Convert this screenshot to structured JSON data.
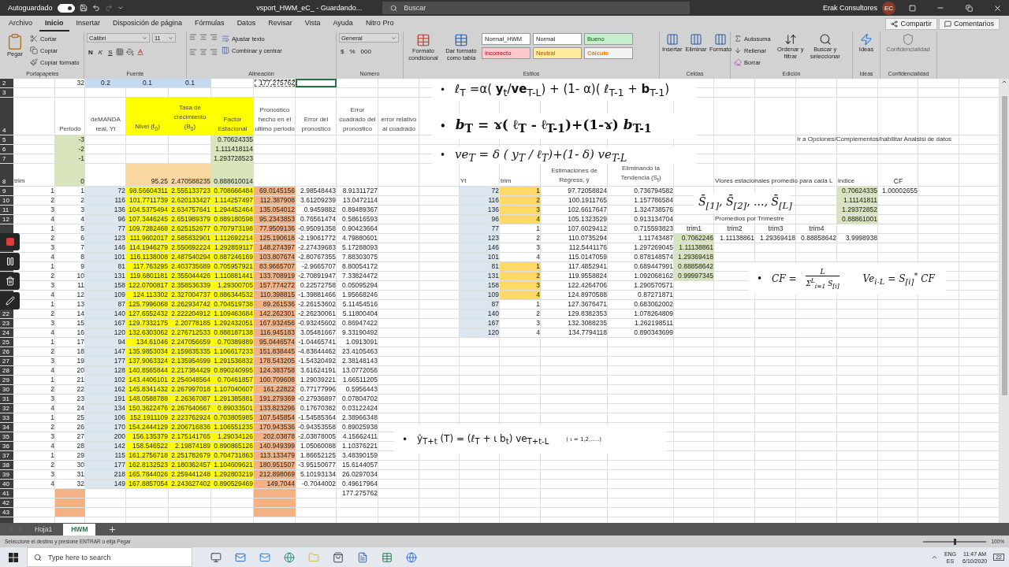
{
  "title_bar": {
    "autosave_label": "Autoguardado",
    "autosave_on": true,
    "document_title": "vsport_HWM_eC_  -  Guardando...",
    "search_placeholder": "Buscar",
    "user_name": "Erak Consultores",
    "user_initials": "EC"
  },
  "menu_tabs": [
    {
      "label": "Archivo",
      "selected": false
    },
    {
      "label": "Inicio",
      "selected": true
    },
    {
      "label": "Insertar",
      "selected": false
    },
    {
      "label": "Disposición de página",
      "selected": false
    },
    {
      "label": "Fórmulas",
      "selected": false
    },
    {
      "label": "Datos",
      "selected": false
    },
    {
      "label": "Revisar",
      "selected": false
    },
    {
      "label": "Vista",
      "selected": false
    },
    {
      "label": "Ayuda",
      "selected": false
    },
    {
      "label": "Nitro Pro",
      "selected": false
    }
  ],
  "share_button": "Compartir",
  "comments_button": "Comentarios",
  "ribbon": [
    {
      "kind": "clipboard",
      "label": "Portapapeles",
      "main": "Pegar",
      "items": [
        "Cortar",
        "Copiar",
        "Copiar formato"
      ]
    },
    {
      "kind": "font",
      "label": "Fuente",
      "font_name": "Calibri",
      "font_size": "11",
      "styles": [
        "N",
        "K",
        "S"
      ]
    },
    {
      "kind": "alignment",
      "label": "Alineación",
      "items": [
        "Ajustar texto",
        "Combinar y centrar"
      ]
    },
    {
      "kind": "number",
      "label": "Número",
      "format": "General",
      "symbols": [
        "$",
        "%",
        "000"
      ]
    },
    {
      "kind": "styles",
      "label": "Estilos",
      "buttons": [
        "Formato condicional",
        "Dar formato como tabla"
      ],
      "cell_styles": [
        {
          "label": "Normal_HWM",
          "kind": "plain"
        },
        {
          "label": "Normal",
          "kind": "plain"
        },
        {
          "label": "Bueno",
          "kind": "good"
        },
        {
          "label": "Incorrecto",
          "kind": "bad"
        },
        {
          "label": "Neutral",
          "kind": "neutral"
        },
        {
          "label": "Cálculo",
          "kind": "calc"
        }
      ]
    },
    {
      "kind": "cells",
      "label": "Celdas",
      "buttons": [
        "Insertar",
        "Eliminar",
        "Formato"
      ]
    },
    {
      "kind": "editing",
      "label": "Edición",
      "items": [
        "Autosuma",
        "Rellenar",
        "Borrar"
      ],
      "buttons": [
        "Ordenar y filtrar",
        "Buscar y seleccionar"
      ]
    },
    {
      "kind": "ideas",
      "label": "Ideas",
      "buttons": [
        "Ideas"
      ]
    },
    {
      "kind": "sensitivity",
      "label": "Confidencialidad",
      "buttons": [
        "Confidencialidad"
      ],
      "disabled": true
    }
  ],
  "sheet": {
    "rows": [
      {
        "number": "2",
        "cells": [
          null,
          "32",
          {
            "text": "0.2",
            "color": "#c5d9f1",
            "kind": "center"
          },
          {
            "text": "0.1",
            "color": "#c5d9f1",
            "kind": "center"
          },
          {
            "text": "0.1",
            "color": "#c5d9f1",
            "kind": "center"
          },
          null,
          {
            "text": "177.275762",
            "copied": true
          },
          {
            "selected": true
          }
        ]
      },
      {
        "number": "3",
        "cells": []
      },
      {
        "number": "4",
        "kind": "header",
        "cells": [
          null,
          {
            "text": "Periodo",
            "kind": "header"
          },
          {
            "text": "deMANDA real, Yt",
            "kind": "header"
          },
          {
            "text": "Nivel (ℓ$_{0}$)",
            "kind": "header",
            "color": "#ffff00"
          },
          {
            "text": "Tasa de crecimiento (B$_{0}$)",
            "kind": "header",
            "color": "#ffff00"
          },
          {
            "text": "Factor Estacional",
            "kind": "header",
            "color": "#ffff00"
          },
          {
            "text": "Pronostico hecho en el ultimo periodo",
            "kind": "header"
          },
          {
            "text": "Error del pronostico",
            "kind": "header"
          },
          {
            "text": "Error cuadrado del pronostico",
            "kind": "header"
          },
          {
            "text": "error relativo al cuadrado",
            "kind": "header"
          }
        ]
      },
      {
        "number": "5",
        "cells": [
          null,
          {
            "text": "-3",
            "color": "#d8e4bc"
          },
          null,
          null,
          null,
          {
            "text": "0.70624335",
            "color": "#d8e4bc"
          },
          null,
          null,
          null,
          null,
          null,
          null,
          null,
          null,
          null,
          null,
          null,
          null,
          {
            "text": "Ir a Opciones/Complementos/habilitar Analsisi de datos",
            "kind": "text"
          }
        ]
      },
      {
        "number": "6",
        "cells": [
          null,
          {
            "text": "-2",
            "color": "#d8e4bc"
          },
          null,
          null,
          null,
          {
            "text": "1.111418114",
            "color": "#d8e4bc"
          }
        ]
      },
      {
        "number": "7",
        "cells": [
          null,
          {
            "text": "-1",
            "color": "#d8e4bc"
          },
          null,
          null,
          null,
          {
            "text": "1.293728523",
            "color": "#d8e4bc"
          }
        ]
      },
      {
        "number": "8",
        "kind": "tall",
        "cells": [
          {
            "text": "trim",
            "kind": "text"
          },
          {
            "text": "0",
            "color": "#d8e4bc"
          },
          null,
          {
            "text": "95.25",
            "color": "#fad7a0"
          },
          {
            "text": "2.470588235",
            "color": "#fad7a0"
          },
          {
            "text": "0.888610014",
            "color": "#d8e4bc"
          },
          null,
          null,
          null,
          null,
          null,
          {
            "text": "Yt",
            "kind": "text"
          },
          {
            "text": "trim",
            "kind": "text"
          },
          {
            "text": "Estimaciones de Regress, ŷ",
            "kind": "header"
          },
          {
            "text": "Eliminando la Tendencia (S$_{t}$)",
            "kind": "header"
          },
          null,
          {
            "text": "Vlores estacionales promedio para cada L",
            "kind": "text"
          },
          null,
          null,
          {
            "text": "indice",
            "kind": "text"
          },
          {
            "text": "CF",
            "kind": "center"
          }
        ]
      },
      {
        "number": "9",
        "cells": [
          "1",
          "1",
          {
            "text": "72",
            "color": "#dce6f1"
          },
          {
            "text": "98.56604311",
            "color": "#ffff00"
          },
          {
            "text": "2.555133723",
            "color": "#ffff00"
          },
          {
            "text": "0.708666484",
            "color": "#ffff00"
          },
          {
            "text": "69.0145156",
            "color": "#f4b183"
          },
          "2.98548443",
          "8.91311727",
          null,
          null,
          {
            "text": "72",
            "color": "#dce6f1"
          },
          {
            "text": "1",
            "color": "#ffd966"
          },
          "97.72058824",
          "0.736794582",
          null,
          null,
          null,
          null,
          {
            "text": "0.70624335",
            "color": "#d8e4bc"
          },
          "1.00002655"
        ]
      },
      {
        "number": "10",
        "cells": [
          "2",
          "2",
          {
            "text": "116",
            "color": "#dce6f1"
          },
          {
            "text": "101.7711739",
            "color": "#ffff00"
          },
          {
            "text": "2.620133427",
            "color": "#ffff00"
          },
          {
            "text": "1.114257497",
            "color": "#ffff00"
          },
          {
            "text": "112.387908",
            "color": "#f4b183"
          },
          "3.61209239",
          "13.0472114",
          null,
          null,
          {
            "text": "116",
            "color": "#dce6f1"
          },
          {
            "text": "2",
            "color": "#ffd966"
          },
          "100.1911765",
          "1.157786584",
          null,
          null,
          null,
          null,
          {
            "text": "1.11141811",
            "color": "#d8e4bc"
          }
        ]
      },
      {
        "number": "11",
        "cells": [
          "3",
          "3",
          {
            "text": "136",
            "color": "#dce6f1"
          },
          {
            "text": "104.5375494",
            "color": "#ffff00"
          },
          {
            "text": "2.634757641",
            "color": "#ffff00"
          },
          {
            "text": "1.294452464",
            "color": "#ffff00"
          },
          {
            "text": "135.054012",
            "color": "#f4b183"
          },
          "0.9459882",
          "0.89489367",
          null,
          null,
          {
            "text": "136",
            "color": "#dce6f1"
          },
          {
            "text": "3",
            "color": "#ffd966"
          },
          "102.6617647",
          "1.324738576",
          null,
          null,
          null,
          null,
          {
            "text": "1.29372852",
            "color": "#d8e4bc"
          }
        ]
      },
      {
        "number": "12",
        "cells": [
          "4",
          "4",
          {
            "text": "96",
            "color": "#dce6f1"
          },
          {
            "text": "107.3446245",
            "color": "#ffff00"
          },
          {
            "text": "2.651989379",
            "color": "#ffff00"
          },
          {
            "text": "0.889180598",
            "color": "#ffff00"
          },
          {
            "text": "95.2343853",
            "color": "#f4b183"
          },
          "0.76561474",
          "0.58616593",
          null,
          null,
          {
            "text": "96",
            "color": "#dce6f1"
          },
          {
            "text": "4",
            "color": "#ffd966"
          },
          "105.1323529",
          "0.913134704",
          null,
          {
            "text": "Promedios por Trimestre",
            "kind": "text"
          },
          null,
          null,
          {
            "text": "0.88861001",
            "color": "#d8e4bc"
          }
        ]
      },
      {
        "cells": [
          "1",
          "5",
          {
            "text": "77",
            "color": "#dce6f1"
          },
          {
            "text": "109.7282468",
            "color": "#ffff00"
          },
          {
            "text": "2.625152677",
            "color": "#ffff00"
          },
          {
            "text": "0.707973198",
            "color": "#ffff00"
          },
          {
            "text": "77.9509136",
            "color": "#f4b183"
          },
          "-0.95091358",
          "0.90423664",
          null,
          null,
          {
            "text": "77",
            "color": "#dce6f1"
          },
          "1",
          "107.6029412",
          "0.715593823",
          {
            "text": "trim1",
            "kind": "center"
          },
          {
            "text": "trim2",
            "kind": "center"
          },
          {
            "text": "trim3",
            "kind": "center"
          },
          {
            "text": "trim4",
            "kind": "center"
          }
        ]
      },
      {
        "cells": [
          "2",
          "6",
          {
            "text": "123",
            "color": "#dce6f1"
          },
          {
            "text": "111.9602017",
            "color": "#ffff00"
          },
          {
            "text": "2.585832901",
            "color": "#ffff00"
          },
          {
            "text": "1.112692214",
            "color": "#ffff00"
          },
          {
            "text": "125.190618",
            "color": "#f4b183"
          },
          "-2.19061772",
          "4.79880601",
          null,
          null,
          {
            "text": "123",
            "color": "#dce6f1"
          },
          "2",
          "110.0735294",
          "1.11743487",
          {
            "text": "0.7062246",
            "color": "#d8e4bc"
          },
          "1.11138861",
          "1.29369418",
          "0.88858642",
          "3.9998938"
        ]
      },
      {
        "cells": [
          "3",
          "7",
          {
            "text": "146",
            "color": "#dce6f1"
          },
          {
            "text": "114.1946279",
            "color": "#ffff00"
          },
          {
            "text": "2.550692224",
            "color": "#ffff00"
          },
          {
            "text": "1.292859117",
            "color": "#ffff00"
          },
          {
            "text": "148.274397",
            "color": "#f4b183"
          },
          "-2.27439683",
          "5.17288093",
          null,
          null,
          {
            "text": "146",
            "color": "#dce6f1"
          },
          "3",
          "112.5441176",
          "1.297269045",
          {
            "text": "1.11138861",
            "color": "#d8e4bc"
          }
        ]
      },
      {
        "cells": [
          "4",
          "8",
          {
            "text": "101",
            "color": "#dce6f1"
          },
          {
            "text": "116.1138008",
            "color": "#ffff00"
          },
          {
            "text": "2.487540294",
            "color": "#ffff00"
          },
          {
            "text": "0.887246169",
            "color": "#ffff00"
          },
          {
            "text": "103.807674",
            "color": "#f4b183"
          },
          "-2.80767355",
          "7.88303075",
          null,
          null,
          {
            "text": "101",
            "color": "#dce6f1"
          },
          "4",
          "115.0147059",
          "0.878148574",
          {
            "text": "1.29369418",
            "color": "#d8e4bc"
          }
        ]
      },
      {
        "cells": [
          "1",
          "9",
          {
            "text": "81",
            "color": "#dce6f1"
          },
          {
            "text": "117.763295",
            "color": "#ffff00"
          },
          {
            "text": "2.403735689",
            "color": "#ffff00"
          },
          {
            "text": "0.705957921",
            "color": "#ffff00"
          },
          {
            "text": "83.9665707",
            "color": "#f4b183"
          },
          "-2.9665707",
          "8.80054172",
          null,
          null,
          {
            "text": "81",
            "color": "#dce6f1"
          },
          {
            "text": "1",
            "color": "#ffd966"
          },
          "117.4852941",
          "0.689447991",
          {
            "text": "0.88858642",
            "color": "#d8e4bc"
          }
        ]
      },
      {
        "cells": [
          "2",
          "10",
          {
            "text": "131",
            "color": "#dce6f1"
          },
          {
            "text": "119.6801181",
            "color": "#ffff00"
          },
          {
            "text": "2.355044426",
            "color": "#ffff00"
          },
          {
            "text": "1.110881441",
            "color": "#ffff00"
          },
          {
            "text": "133.708919",
            "color": "#f4b183"
          },
          "-2.70891947",
          "7.33824472",
          null,
          null,
          {
            "text": "131",
            "color": "#dce6f1"
          },
          {
            "text": "2",
            "color": "#ffd966"
          },
          "119.9558824",
          "1.092068162",
          {
            "text": "0.99997345",
            "color": "#d8e4bc"
          }
        ]
      },
      {
        "cells": [
          "3",
          "11",
          {
            "text": "158",
            "color": "#dce6f1"
          },
          {
            "text": "122.0700817",
            "color": "#ffff00"
          },
          {
            "text": "2.358536339",
            "color": "#ffff00"
          },
          {
            "text": "1.29300705",
            "color": "#ffff00"
          },
          {
            "text": "157.774272",
            "color": "#f4b183"
          },
          "0.22572758",
          "0.05095294",
          null,
          null,
          {
            "text": "158",
            "color": "#dce6f1"
          },
          {
            "text": "3",
            "color": "#ffd966"
          },
          "122.4264706",
          "1.290570571"
        ]
      },
      {
        "cells": [
          "4",
          "12",
          {
            "text": "109",
            "color": "#dce6f1"
          },
          {
            "text": "124.113302",
            "color": "#ffff00"
          },
          {
            "text": "2.327004737",
            "color": "#ffff00"
          },
          {
            "text": "0.886344532",
            "color": "#ffff00"
          },
          {
            "text": "110.398815",
            "color": "#f4b183"
          },
          "-1.39881466",
          "1.95668246",
          null,
          null,
          {
            "text": "109",
            "color": "#dce6f1"
          },
          {
            "text": "4",
            "color": "#ffd966"
          },
          "124.8970588",
          "0.87271871"
        ]
      },
      {
        "cells": [
          "1",
          "13",
          {
            "text": "87",
            "color": "#dce6f1"
          },
          {
            "text": "125.7996068",
            "color": "#ffff00"
          },
          {
            "text": "2.262934742",
            "color": "#ffff00"
          },
          {
            "text": "0.704519738",
            "color": "#ffff00"
          },
          {
            "text": "89.261536",
            "color": "#f4b183"
          },
          "-2.26153602",
          "5.11454516",
          null,
          null,
          {
            "text": "87",
            "color": "#dce6f1"
          },
          "1",
          "127.3676471",
          "0.683062002"
        ]
      },
      {
        "number": "22",
        "cells": [
          "2",
          "14",
          {
            "text": "140",
            "color": "#dce6f1"
          },
          {
            "text": "127.6552432",
            "color": "#ffff00"
          },
          {
            "text": "2.222204912",
            "color": "#ffff00"
          },
          {
            "text": "1.109463684",
            "color": "#ffff00"
          },
          {
            "text": "142.262301",
            "color": "#f4b183"
          },
          "-2.26230061",
          "5.11800404",
          null,
          null,
          {
            "text": "140",
            "color": "#dce6f1"
          },
          "2",
          "129.8382353",
          "1.078264809"
        ]
      },
      {
        "number": "23",
        "cells": [
          "3",
          "15",
          {
            "text": "167",
            "color": "#dce6f1"
          },
          {
            "text": "129.7332175",
            "color": "#ffff00"
          },
          {
            "text": "2.20778185",
            "color": "#ffff00"
          },
          {
            "text": "1.292432051",
            "color": "#ffff00"
          },
          {
            "text": "167.932456",
            "color": "#f4b183"
          },
          "-0.93245602",
          "0.86947422",
          null,
          null,
          {
            "text": "167",
            "color": "#dce6f1"
          },
          "3",
          "132.3088235",
          "1.262198511"
        ]
      },
      {
        "number": "24",
        "cells": [
          "4",
          "16",
          {
            "text": "120",
            "color": "#dce6f1"
          },
          {
            "text": "132.6303062",
            "color": "#ffff00"
          },
          {
            "text": "2.276712533",
            "color": "#ffff00"
          },
          {
            "text": "0.888187138",
            "color": "#ffff00"
          },
          {
            "text": "116.945183",
            "color": "#f4b183"
          },
          "3.05481667",
          "9.33190492",
          null,
          null,
          {
            "text": "120",
            "color": "#dce6f1"
          },
          "4",
          "134.7794118",
          "0.890343699"
        ]
      },
      {
        "number": "25",
        "cells": [
          "1",
          "17",
          {
            "text": "94",
            "color": "#dce6f1"
          },
          {
            "text": "134.61046",
            "color": "#ffff00"
          },
          {
            "text": "2.247056659",
            "color": "#ffff00"
          },
          {
            "text": "0.70389889",
            "color": "#ffff00"
          },
          {
            "text": "95.0446574",
            "color": "#f4b183"
          },
          "-1.04465741",
          "1.0913091"
        ]
      },
      {
        "number": "26",
        "cells": [
          "2",
          "18",
          {
            "text": "147",
            "color": "#dce6f1"
          },
          {
            "text": "135.9853034",
            "color": "#ffff00"
          },
          {
            "text": "2.159835335",
            "color": "#ffff00"
          },
          {
            "text": "1.106617233",
            "color": "#ffff00"
          },
          {
            "text": "151.838445",
            "color": "#f4b183"
          },
          "-4.83844462",
          "23.4105463"
        ]
      },
      {
        "number": "27",
        "cells": [
          "3",
          "19",
          {
            "text": "177",
            "color": "#dce6f1"
          },
          {
            "text": "137.9063324",
            "color": "#ffff00"
          },
          {
            "text": "2.135954699",
            "color": "#ffff00"
          },
          {
            "text": "1.291536832",
            "color": "#ffff00"
          },
          {
            "text": "178.543205",
            "color": "#f4b183"
          },
          "-1.54320492",
          "2.38148143"
        ]
      },
      {
        "number": "28",
        "cells": [
          "4",
          "20",
          {
            "text": "128",
            "color": "#dce6f1"
          },
          {
            "text": "140.8565844",
            "color": "#ffff00"
          },
          {
            "text": "2.217384429",
            "color": "#ffff00"
          },
          {
            "text": "0.890240995",
            "color": "#ffff00"
          },
          {
            "text": "124.383758",
            "color": "#f4b183"
          },
          "3.61624191",
          "13.0772056"
        ]
      },
      {
        "number": "29",
        "cells": [
          "1",
          "21",
          {
            "text": "102",
            "color": "#dce6f1"
          },
          {
            "text": "143.4406101",
            "color": "#ffff00"
          },
          {
            "text": "2.254048564",
            "color": "#ffff00"
          },
          {
            "text": "0.70461857",
            "color": "#ffff00"
          },
          {
            "text": "100.709608",
            "color": "#f4b183"
          },
          "1.29039221",
          "1.66511205"
        ]
      },
      {
        "number": "30",
        "cells": [
          "2",
          "22",
          {
            "text": "162",
            "color": "#dce6f1"
          },
          {
            "text": "145.8341432",
            "color": "#ffff00"
          },
          {
            "text": "2.267997018",
            "color": "#ffff00"
          },
          {
            "text": "1.107040607",
            "color": "#ffff00"
          },
          {
            "text": "161.22822",
            "color": "#f4b183"
          },
          "0.77177996",
          "0.5956443"
        ]
      },
      {
        "number": "31",
        "cells": [
          "3",
          "23",
          {
            "text": "191",
            "color": "#dce6f1"
          },
          {
            "text": "148.0588788",
            "color": "#ffff00"
          },
          {
            "text": "2.26367087",
            "color": "#ffff00"
          },
          {
            "text": "1.291385881",
            "color": "#ffff00"
          },
          {
            "text": "191.279369",
            "color": "#f4b183"
          },
          "-0.27936897",
          "0.07804702"
        ]
      },
      {
        "number": "32",
        "cells": [
          "4",
          "24",
          {
            "text": "134",
            "color": "#dce6f1"
          },
          {
            "text": "150.3622476",
            "color": "#ffff00"
          },
          {
            "text": "2.267640667",
            "color": "#ffff00"
          },
          {
            "text": "0.89033501",
            "color": "#ffff00"
          },
          {
            "text": "133.823296",
            "color": "#f4b183"
          },
          "0.17670382",
          "0.03122424"
        ]
      },
      {
        "number": "33",
        "cells": [
          "1",
          "25",
          {
            "text": "106",
            "color": "#dce6f1"
          },
          {
            "text": "152.1911109",
            "color": "#ffff00"
          },
          {
            "text": "2.223762924",
            "color": "#ffff00"
          },
          {
            "text": "0.703805985",
            "color": "#ffff00"
          },
          {
            "text": "107.545854",
            "color": "#f4b183"
          },
          "-1.54585364",
          "2.38966348"
        ]
      },
      {
        "number": "34",
        "cells": [
          "2",
          "26",
          {
            "text": "170",
            "color": "#dce6f1"
          },
          {
            "text": "154.2444129",
            "color": "#ffff00"
          },
          {
            "text": "2.206716836",
            "color": "#ffff00"
          },
          {
            "text": "1.106551235",
            "color": "#ffff00"
          },
          {
            "text": "170.943536",
            "color": "#f4b183"
          },
          "-0.94353558",
          "0.89025938"
        ]
      },
      {
        "number": "35",
        "cells": [
          "3",
          "27",
          {
            "text": "200",
            "color": "#dce6f1"
          },
          {
            "text": "156.135379",
            "color": "#ffff00"
          },
          {
            "text": "2.175141765",
            "color": "#ffff00"
          },
          {
            "text": "1.29034126",
            "color": "#ffff00"
          },
          {
            "text": "202.03878",
            "color": "#f4b183"
          },
          "-2.03878005",
          "4.15662411"
        ]
      },
      {
        "number": "36",
        "cells": [
          "4",
          "28",
          {
            "text": "142",
            "color": "#dce6f1"
          },
          {
            "text": "158.546522",
            "color": "#ffff00"
          },
          {
            "text": "2.19874189",
            "color": "#ffff00"
          },
          {
            "text": "0.890865126",
            "color": "#ffff00"
          },
          {
            "text": "140.949399",
            "color": "#f4b183"
          },
          "1.05060088",
          "1.10376221"
        ]
      },
      {
        "number": "37",
        "cells": [
          "1",
          "29",
          {
            "text": "115",
            "color": "#dce6f1"
          },
          {
            "text": "161.2756718",
            "color": "#ffff00"
          },
          {
            "text": "2.251782679",
            "color": "#ffff00"
          },
          {
            "text": "0.704731863",
            "color": "#ffff00"
          },
          {
            "text": "113.133479",
            "color": "#f4b183"
          },
          "1.86652125",
          "3.48390159"
        ]
      },
      {
        "number": "38",
        "cells": [
          "2",
          "30",
          {
            "text": "177",
            "color": "#dce6f1"
          },
          {
            "text": "162.8132523",
            "color": "#ffff00"
          },
          {
            "text": "2.180362457",
            "color": "#ffff00"
          },
          {
            "text": "1.104609621",
            "color": "#ffff00"
          },
          {
            "text": "180.951507",
            "color": "#f4b183"
          },
          "-3.95150677",
          "15.6144057"
        ]
      },
      {
        "number": "39",
        "cells": [
          "3",
          "31",
          {
            "text": "218",
            "color": "#dce6f1"
          },
          {
            "text": "165.7844026",
            "color": "#ffff00"
          },
          {
            "text": "2.259441248",
            "color": "#ffff00"
          },
          {
            "text": "1.292803219",
            "color": "#ffff00"
          },
          {
            "text": "212.898069",
            "color": "#f4b183"
          },
          "5.10193134",
          "26.0297034"
        ]
      },
      {
        "number": "40",
        "cells": [
          "4",
          "32",
          {
            "text": "149",
            "color": "#dce6f1"
          },
          {
            "text": "167.8857054",
            "color": "#ffff00"
          },
          {
            "text": "2.243627402",
            "color": "#ffff00"
          },
          {
            "text": "0.890529469",
            "color": "#ffff00"
          },
          {
            "text": "149.7044",
            "color": "#f4b183"
          },
          "-0.7044002",
          "0.49617964"
        ]
      },
      {
        "number": "41",
        "cells": [
          null,
          {
            "color": "#f4b183"
          },
          null,
          null,
          null,
          null,
          {
            "color": "#f4b183"
          },
          null,
          "177.275762"
        ]
      },
      {
        "number": "42",
        "cells": [
          null,
          {
            "color": "#f4b183"
          },
          null,
          null,
          null,
          null,
          {
            "color": "#f4b183"
          }
        ]
      },
      {
        "number": "43",
        "cells": [
          null,
          {
            "color": "#f4b183"
          },
          null,
          null,
          null,
          null,
          {
            "color": "#f4b183"
          }
        ]
      }
    ]
  },
  "formulas": [
    {
      "bullet": "•",
      "kind": "line",
      "text": "ℓ$_{T}$ =α( **y**$_{t}$/**ve**$_{T-L}$) + (1- α)( ℓ$_{T-1}$ + **b**$_{T-1}$)"
    },
    {
      "bullet": "•",
      "kind": "line",
      "text": "*b*$_{T}$ = ɤ( ℓ$_{T}$ -  ℓ$_{T-1}$)+(1-ɤ) *b*$_{T-1}$"
    },
    {
      "bullet": "•",
      "kind": "line",
      "text": "ve$_{T}$ = δ ( y$_{T}$ / ℓ$_{T}$)+(1- δ) ve$_{T-L}$"
    },
    {
      "kind": "line",
      "text": "S̄$_{[1]}$, S̄$_{[2]}$, ..., S̄$_{[L]}$"
    },
    {
      "bullet": "•",
      "kind": "fraction",
      "lhs": "CF =",
      "numerator": "L",
      "denominator": "Σ$^{L}$$_{i=1}$ S$_{[i]}$",
      "rhs": "Ve$_{i-L}$ = S$_{[i]}$$^{*}$  CF"
    },
    {
      "bullet": "•",
      "kind": "line",
      "text": "ŷ$_{T+t}$ (T) =  (ℓ$_{T}$ + ι b$_{t}$)  ve$_{T+t-L}$",
      "note": "( ι = 1,2,.....)"
    }
  ],
  "sheet_tabs": [
    {
      "label": "Hoja1",
      "selected": false
    },
    {
      "label": "HWM",
      "selected": true
    }
  ],
  "status_bar": {
    "message": "Seleccione el destino y presione ENTRAR o elija Pegar",
    "zoom": {
      "reading": "100%",
      "level": 0.5
    }
  },
  "taskbar": {
    "search_placeholder": "Type here to search",
    "language": "ENG",
    "layout": "ES",
    "time": "11:47 AM",
    "date": "6/10/2020",
    "notifications": "22"
  }
}
